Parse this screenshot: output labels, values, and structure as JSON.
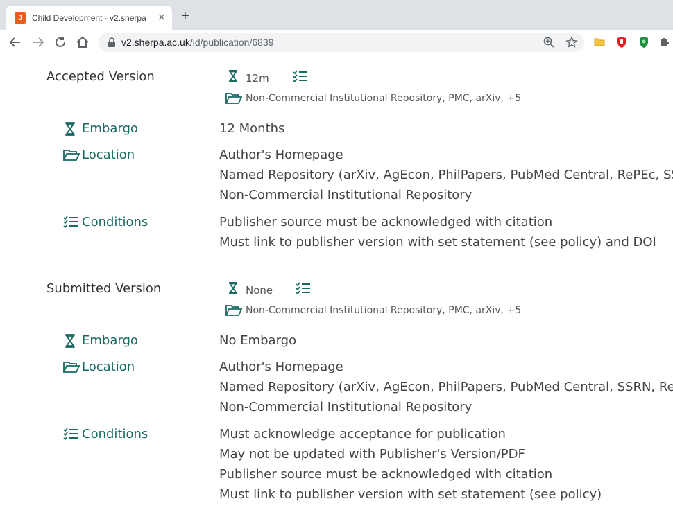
{
  "browser": {
    "tab_title": "Child Development - v2.sherpa",
    "favicon_letter": "J",
    "tab_close": "×",
    "new_tab": "+",
    "url_host": "v2.sherpa.ac.uk",
    "url_path": "/id/publication/6839",
    "accent": "#e8601c"
  },
  "versions": [
    {
      "title": "Accepted Version",
      "summary": {
        "embargo": "12m",
        "locations": "Non-Commercial Institutional Repository, PMC, arXiv, +5"
      },
      "labels": {
        "embargo": "Embargo",
        "location": "Location",
        "conditions": "Conditions"
      },
      "embargo": "12 Months",
      "locations": [
        "Author's Homepage",
        "Named Repository (arXiv, AgEcon, PhilPapers, PubMed Central, RePEc, SSRN)",
        "Non-Commercial Institutional Repository"
      ],
      "conditions": [
        "Publisher source must be acknowledged with citation",
        "Must link to publisher version with set statement (see policy) and DOI"
      ]
    },
    {
      "title": "Submitted Version",
      "summary": {
        "embargo": "None",
        "locations": "Non-Commercial Institutional Repository, PMC, arXiv, +5"
      },
      "labels": {
        "embargo": "Embargo",
        "location": "Location",
        "conditions": "Conditions"
      },
      "embargo": "No Embargo",
      "locations": [
        "Author's Homepage",
        "Named Repository (arXiv, AgEcon, PhilPapers, PubMed Central, SSRN, RePEc)",
        "Non-Commercial Institutional Repository"
      ],
      "conditions": [
        "Must acknowledge acceptance for publication",
        "May not be updated with Publisher's Version/PDF",
        "Publisher source must be acknowledged with citation",
        "Must link to publisher version with set statement (see policy)"
      ]
    }
  ],
  "icons": {
    "embargo": "hourglass-icon",
    "location": "folder-open-icon",
    "conditions": "checklist-icon"
  },
  "colors": {
    "icon": "#1a6a63",
    "label": "#1a6a63"
  }
}
